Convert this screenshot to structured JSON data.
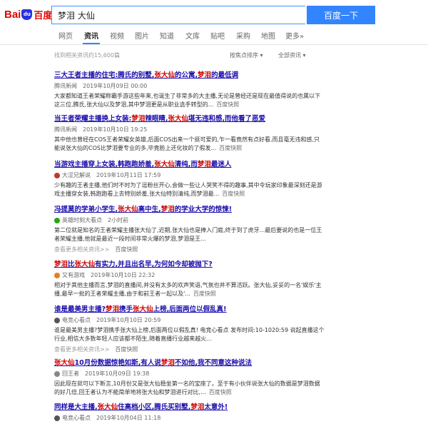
{
  "header": {
    "logo_bai": "Bai",
    "logo_paw": "du",
    "logo_text": "百度",
    "search_value": "梦泪 大仙",
    "search_button": "百度一下"
  },
  "tabs": [
    {
      "label": "网页"
    },
    {
      "label": "资讯",
      "active": true
    },
    {
      "label": "视频"
    },
    {
      "label": "图片"
    },
    {
      "label": "知道"
    },
    {
      "label": "文库"
    },
    {
      "label": "贴吧"
    },
    {
      "label": "采购"
    },
    {
      "label": "地图"
    },
    {
      "label": "更多»"
    }
  ],
  "results_count": "找到相关资讯约15,600篇",
  "sort_focus": "按焦点排序",
  "sort_all": "全部资讯",
  "results": [
    {
      "title": [
        {
          "t": "三大王者主播的住宅:腾氏的别墅,"
        },
        {
          "t": "张大仙",
          "hl": true
        },
        {
          "t": "的公寓,"
        },
        {
          "t": "梦泪",
          "hl": true
        },
        {
          "t": "的最低调"
        }
      ],
      "source": "腾讯新闻",
      "time": "2019年10月09日 00:00",
      "snippet": "大家都知道王者荣耀称霸手游这些年来,也诞生了非常多的大主播,无论是曾经还是现在最值得说的也属以下这三位,腾氏,张大仙以及梦泪,其中梦泪更是从职业选手转型的...",
      "kuaizhao": "百度快照"
    },
    {
      "title": [
        {
          "t": "当王者荣耀主播换上女装:"
        },
        {
          "t": "梦泪",
          "hl": true
        },
        {
          "t": "辣眼睛,"
        },
        {
          "t": "张大仙",
          "hl": true
        },
        {
          "t": "堪无违和感,而他看了恶爱"
        }
      ],
      "source": "腾讯新闻",
      "time": "2019年10月10日 19:25",
      "snippet": "其中他也曾经在COS王者荣耀女英雄,后面COS出来一个挺可爱的,乍一看竟然有点好看,而且毫无违和感,只能说张大仙的COS比梦泪要专业的多,毕竟脸上还化妆的了假发...",
      "kuaizhao": "百度快照"
    },
    {
      "title": [
        {
          "t": "当游戏主播穿上女装,韩跑跑娇羞,"
        },
        {
          "t": "张大仙",
          "hl": true
        },
        {
          "t": "清纯,而"
        },
        {
          "t": "梦泪",
          "hl": true
        },
        {
          "t": "最迷人"
        }
      ],
      "source": "大涩兄解说",
      "time": "2019年10月11日 17:59",
      "icon_color": "#c0392b",
      "snippet": "少有趣的王者主播,他们时不时为了逗粉丝开心,会做一些让人哭笑不得的趣事,其中令玩家印象最深刻还是游戏主播穿女装,韩跑跑看上去特别娇羞,张大仙特别清纯,而梦泪最...",
      "kuaizhao": "百度快照"
    },
    {
      "title": [
        {
          "t": "冯提莫的学弟小学生,"
        },
        {
          "t": "张大仙",
          "hl": true
        },
        {
          "t": "高中生,"
        },
        {
          "t": "梦泪",
          "hl": true
        },
        {
          "t": "的学业大学的惊悚!"
        }
      ],
      "source": "英雄时刻大看点",
      "time": "2小时前",
      "icon_color": "#2aa515",
      "snippet": "第二位就是知名的王者荣耀主播张大仙了,近期,张大仙也是捧入门庭,终于到了虎牙...最后要说的也是一位王者荣耀主播,他就是最近一段时间非常火爆的梦泪,梦泪是王...",
      "more": "查看更多相关资讯>>",
      "kuaizhao": "百度快照"
    },
    {
      "title": [
        {
          "t": "梦泪",
          "hl": true
        },
        {
          "t": "比"
        },
        {
          "t": "张大仙",
          "hl": true
        },
        {
          "t": "有实力,并且出名早,为何如今却被抛下?"
        }
      ],
      "source": "又有游戏",
      "time": "2019年10月10日 22:32",
      "icon_color": "#e67e22",
      "snippet": "相对于其他主播而言,梦泪的直播间,并没有太多的欢声笑语,气氛也并不算活跃。张大仙,妥妥的一名'娱乐'主播,最早一批的王者荣耀主播,由于和前王者一起以及'...",
      "kuaizhao": "百度快照"
    },
    {
      "title": [
        {
          "t": "谁是最美男主播?"
        },
        {
          "t": "梦泪",
          "hl": true
        },
        {
          "t": "携手"
        },
        {
          "t": "张大仙",
          "hl": true
        },
        {
          "t": "上榜,后面两位以假乱真!"
        }
      ],
      "source": "电竞心看点",
      "time": "2019年10月10日 20:59",
      "icon_color": "#555555",
      "snippet": "谁是最美男主播?梦泪携手张大仙上榜,后面两位以假乱真! 电竞心看点 发布时间:10-1020:59 说起直播这个行业,相信大多数年轻人应该都不陌生,随着直播行业越来越火...",
      "more": "查看更多相关资讯>>",
      "kuaizhao": "百度快照"
    },
    {
      "title": [
        {
          "t": "张大仙",
          "hl": true
        },
        {
          "t": "10月份数据惊艳如斯,有人说"
        },
        {
          "t": "梦泪",
          "hl": true
        },
        {
          "t": "不如他,我不同意这种说法"
        }
      ],
      "source": "回王者",
      "time": "2019年10月09日 19:38",
      "icon_color": "#888888",
      "snippet": "因此现在就可以下断言,10月份又是张大仙稳坐第一名的宝座了。至于有小伙伴说张大仙的数据是梦泪数据的好几倍,回王者认为不能简单地将张大仙和梦泪进行对比,...",
      "kuaizhao": "百度快照"
    },
    {
      "title": [
        {
          "t": "同样是大主播,"
        },
        {
          "t": "张大仙",
          "hl": true
        },
        {
          "t": "住高档小区,腾氏买别墅,"
        },
        {
          "t": "梦泪",
          "hl": true
        },
        {
          "t": "太意外!"
        }
      ],
      "source": "电竞心看点",
      "time": "2019年10月04日 11:18",
      "icon_color": "#555555"
    }
  ]
}
